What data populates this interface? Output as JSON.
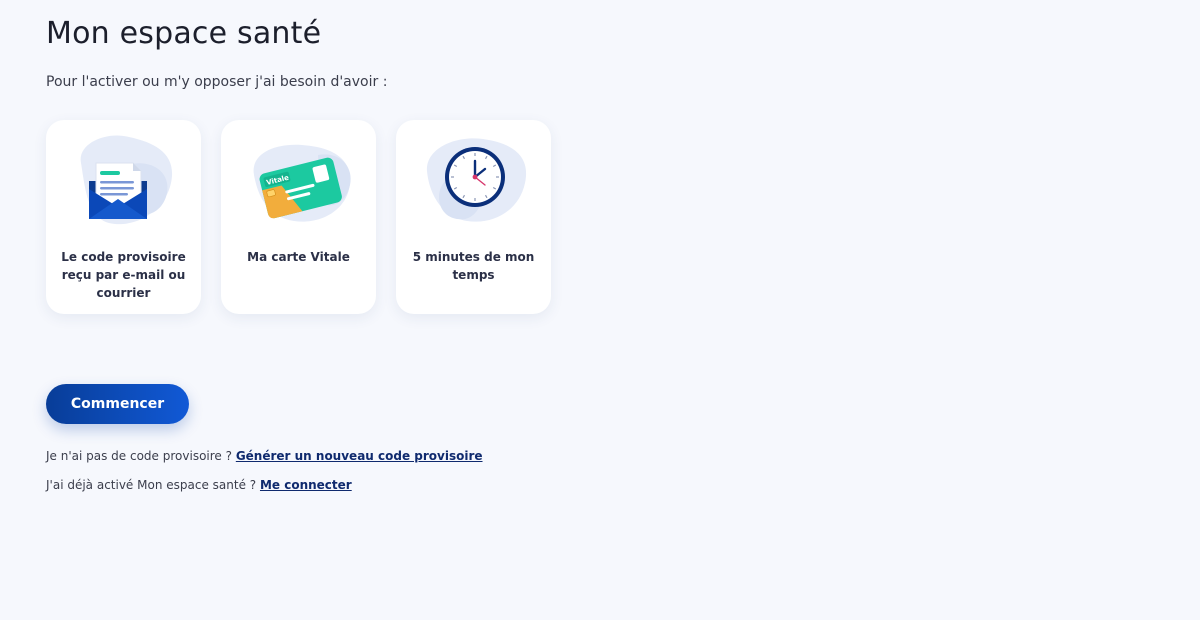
{
  "page": {
    "title": "Mon espace santé",
    "intro": "Pour l'activer ou m'y opposer j'ai besoin d'avoir :"
  },
  "cards": [
    {
      "icon": "envelope-document-icon",
      "label": "Le code provisoire reçu par e-mail ou courrier"
    },
    {
      "icon": "vitale-card-icon",
      "label": "Ma carte Vitale",
      "card_text": "Vitale"
    },
    {
      "icon": "clock-icon",
      "label": "5 minutes de mon temps"
    }
  ],
  "actions": {
    "start_label": "Commencer"
  },
  "links": {
    "no_code_text": "Je n'ai pas de code provisoire ?",
    "no_code_link": "Générer un nouveau code provisoire",
    "already_text": "J'ai déjà activé Mon espace santé ?",
    "already_link": "Me connecter"
  },
  "colors": {
    "background": "#f6f8fd",
    "primary": "#0a47b5",
    "link": "#0f2a6e",
    "accent_green": "#1cc9a0",
    "blob": "#e4eaf7"
  }
}
